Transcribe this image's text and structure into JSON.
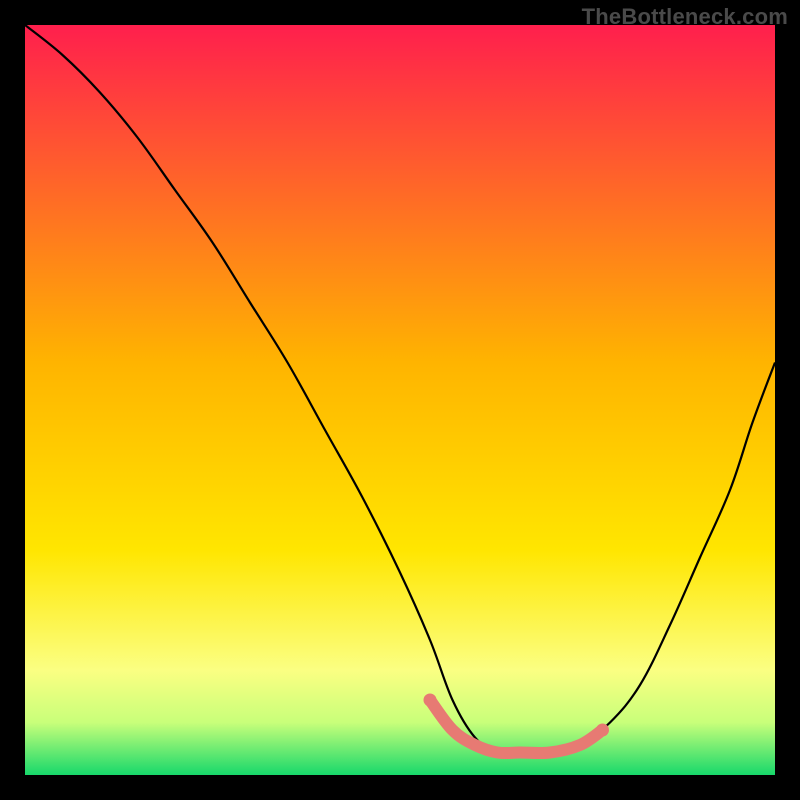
{
  "watermark": "TheBottleneck.com",
  "colors": {
    "background_black": "#000000",
    "curve": "#000000",
    "highlight": "#e77a73",
    "gradient_stops": [
      {
        "offset": "0%",
        "color": "#ff1f4d"
      },
      {
        "offset": "45%",
        "color": "#ffb400"
      },
      {
        "offset": "70%",
        "color": "#ffe600"
      },
      {
        "offset": "86%",
        "color": "#fbff82"
      },
      {
        "offset": "93%",
        "color": "#c8ff7a"
      },
      {
        "offset": "100%",
        "color": "#17d86b"
      }
    ]
  },
  "chart_data": {
    "type": "line",
    "title": "",
    "xlabel": "",
    "ylabel": "",
    "x_range": [
      0,
      100
    ],
    "y_range": [
      0,
      100
    ],
    "note": "Bottleneck-style V curve. Left branch descends from top-left to the flat valley near x≈57–72, right branch ascends to ~(100,55). The salmon highlight marks the low-bottleneck optimum span.",
    "series": [
      {
        "name": "left_branch",
        "x": [
          0,
          5,
          10,
          15,
          20,
          25,
          30,
          35,
          40,
          45,
          50,
          54,
          57,
          60,
          63,
          66
        ],
        "y": [
          100,
          96,
          91,
          85,
          78,
          71,
          63,
          55,
          46,
          37,
          27,
          18,
          10,
          5,
          3,
          3
        ]
      },
      {
        "name": "right_branch",
        "x": [
          66,
          70,
          74,
          78,
          82,
          86,
          90,
          94,
          97,
          100
        ],
        "y": [
          3,
          3,
          4,
          7,
          12,
          20,
          29,
          38,
          47,
          55
        ]
      }
    ],
    "highlight": {
      "name": "optimal_zone",
      "x": [
        54,
        57,
        60,
        63,
        66,
        70,
        74,
        77
      ],
      "y": [
        10,
        6,
        4,
        3,
        3,
        3,
        4,
        6
      ]
    }
  }
}
